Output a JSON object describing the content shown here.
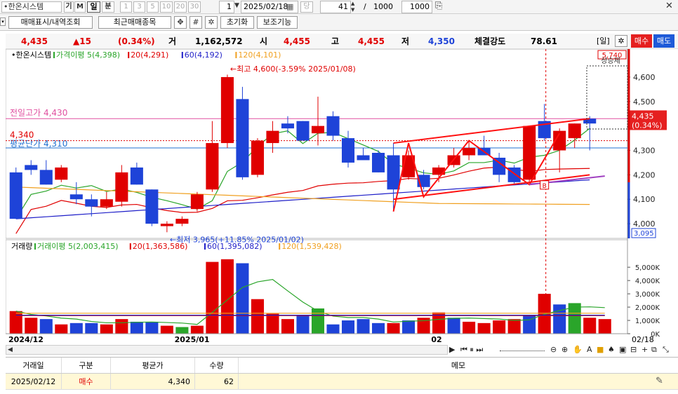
{
  "toolbar": {
    "stock_name": "•한온시스템",
    "period_buttons": [
      "기",
      "M",
      "일",
      "분",
      "1",
      "3",
      "5",
      "10",
      "20",
      "30"
    ],
    "period_dim": [
      false,
      false,
      false,
      false,
      true,
      true,
      true,
      true,
      true,
      true
    ],
    "period_selected": 2,
    "count_field": "1",
    "date_field": "2025/02/18",
    "date_btn2": "당",
    "bars_count": "41",
    "separator": "/",
    "total_bars": "1000",
    "max_bars": "1000"
  },
  "toolbar2": {
    "btn_trade_display": "매매표시/내역조회",
    "btn_recent_items": "최근매매종목",
    "btn_reset": "초기화",
    "btn_aux": "보조기능"
  },
  "infobar": {
    "price": "4,435",
    "change": "▲15",
    "change_pct": "(0.34%)",
    "vol_label": "거",
    "volume": "1,162,572",
    "open_label": "시",
    "open": "4,455",
    "high_label": "고",
    "high": "4,455",
    "low_label": "저",
    "low": "4,350",
    "strength_label": "체결강도",
    "strength": "78.61",
    "period_tag": "[일]",
    "buy_btn": "매수",
    "sell_btn": "매도"
  },
  "chart_data": [
    {
      "type": "candlestick",
      "title": "•한온시스템",
      "legend": [
        {
          "name": "가격이평 5(4,398)",
          "color": "#2aa52a"
        },
        {
          "name": "20(4,291)",
          "color": "#e00000"
        },
        {
          "name": "60(4,192)",
          "color": "#1e1ec8"
        },
        {
          "name": "120(4,101)",
          "color": "#f0a020"
        }
      ],
      "ylim": [
        3940,
        4640
      ],
      "yticks": [
        4000,
        4100,
        4200,
        4300,
        4400,
        4500,
        4600
      ],
      "ytick_labels": [
        "4,000",
        "4,100",
        "4,200",
        "4,300",
        "4,400",
        "4,500",
        "4,600"
      ],
      "candles": [
        {
          "o": 4210,
          "h": 4230,
          "l": 4020,
          "c": 4020
        },
        {
          "o": 4240,
          "h": 4260,
          "l": 4200,
          "c": 4220
        },
        {
          "o": 4220,
          "h": 4260,
          "l": 4160,
          "c": 4160
        },
        {
          "o": 4180,
          "h": 4240,
          "l": 4170,
          "c": 4230
        },
        {
          "o": 4120,
          "h": 4170,
          "l": 4080,
          "c": 4100
        },
        {
          "o": 4100,
          "h": 4120,
          "l": 4030,
          "c": 4070
        },
        {
          "o": 4070,
          "h": 4130,
          "l": 4060,
          "c": 4100
        },
        {
          "o": 4090,
          "h": 4240,
          "l": 4070,
          "c": 4210
        },
        {
          "o": 4230,
          "h": 4250,
          "l": 4160,
          "c": 4160
        },
        {
          "o": 4140,
          "h": 4140,
          "l": 3990,
          "c": 4000
        },
        {
          "o": 3990,
          "h": 4010,
          "l": 3965,
          "c": 4000
        },
        {
          "o": 4000,
          "h": 4030,
          "l": 3990,
          "c": 4020
        },
        {
          "o": 4060,
          "h": 4130,
          "l": 4050,
          "c": 4120
        },
        {
          "o": 4140,
          "h": 4420,
          "l": 4130,
          "c": 4330
        },
        {
          "o": 4330,
          "h": 4610,
          "l": 4310,
          "c": 4600
        },
        {
          "o": 4510,
          "h": 4560,
          "l": 4180,
          "c": 4190
        },
        {
          "o": 4200,
          "h": 4350,
          "l": 4190,
          "c": 4340
        },
        {
          "o": 4330,
          "h": 4420,
          "l": 4290,
          "c": 4380
        },
        {
          "o": 4410,
          "h": 4440,
          "l": 4370,
          "c": 4390
        },
        {
          "o": 4420,
          "h": 4420,
          "l": 4340,
          "c": 4340
        },
        {
          "o": 4370,
          "h": 4520,
          "l": 4320,
          "c": 4400
        },
        {
          "o": 4440,
          "h": 4460,
          "l": 4340,
          "c": 4360
        },
        {
          "o": 4350,
          "h": 4380,
          "l": 4230,
          "c": 4250
        },
        {
          "o": 4280,
          "h": 4310,
          "l": 4270,
          "c": 4260
        },
        {
          "o": 4290,
          "h": 4300,
          "l": 4210,
          "c": 4210
        },
        {
          "o": 4280,
          "h": 4330,
          "l": 4050,
          "c": 4140
        },
        {
          "o": 4190,
          "h": 4300,
          "l": 4180,
          "c": 4280
        },
        {
          "o": 4200,
          "h": 4220,
          "l": 4140,
          "c": 4150
        },
        {
          "o": 4200,
          "h": 4240,
          "l": 4170,
          "c": 4230
        },
        {
          "o": 4240,
          "h": 4310,
          "l": 4230,
          "c": 4280
        },
        {
          "o": 4280,
          "h": 4340,
          "l": 4260,
          "c": 4310
        },
        {
          "o": 4310,
          "h": 4360,
          "l": 4280,
          "c": 4280
        },
        {
          "o": 4270,
          "h": 4290,
          "l": 4170,
          "c": 4200
        },
        {
          "o": 4230,
          "h": 4240,
          "l": 4160,
          "c": 4170
        },
        {
          "o": 4180,
          "h": 4400,
          "l": 4170,
          "c": 4400
        },
        {
          "o": 4420,
          "h": 4490,
          "l": 4340,
          "c": 4350
        },
        {
          "o": 4300,
          "h": 4390,
          "l": 4210,
          "c": 4380
        },
        {
          "o": 4350,
          "h": 4410,
          "l": 4310,
          "c": 4410
        },
        {
          "o": 4430,
          "h": 4440,
          "l": 4300,
          "c": 4410
        }
      ],
      "annotations": {
        "high": "←최고 4,600(-3.59% 2025/01/08)",
        "low": "←최저 3,965(+11.85% 2025/01/02)",
        "prev_high_label": "전일고가 4,430",
        "avg_price_label": "평균단가 4,310",
        "buy_price": "4,340",
        "top_right_badge": "5,740",
        "top_right_tag": "상승제",
        "current_price": "4,435",
        "current_pct": "(0.34%)",
        "low_right": "3,095",
        "marker": "B"
      }
    },
    {
      "type": "bar",
      "title": "거래량",
      "legend": [
        {
          "name": "거래이평 5(2,003,415)",
          "color": "#2aa52a"
        },
        {
          "name": "20(1,363,586)",
          "color": "#e00000"
        },
        {
          "name": "60(1,395,082)",
          "color": "#1e1ec8"
        },
        {
          "name": "120(1,539,428)",
          "color": "#f0a020"
        }
      ],
      "ylim": [
        0,
        5800000
      ],
      "yticks": [
        0,
        1000000,
        2000000,
        3000000,
        4000000,
        5000000
      ],
      "ytick_labels": [
        "0K",
        "1,000K",
        "2,000K",
        "3,000K",
        "4,000K",
        "5,000K"
      ],
      "values": [
        1700000,
        1200000,
        1100000,
        700000,
        800000,
        800000,
        700000,
        1100000,
        900000,
        900000,
        600000,
        500000,
        600000,
        5400000,
        5600000,
        5300000,
        2600000,
        1500000,
        1100000,
        1400000,
        1900000,
        700000,
        1000000,
        1100000,
        800000,
        800000,
        1000000,
        1200000,
        1600000,
        1200000,
        900000,
        800000,
        1000000,
        1100000,
        1400000,
        3000000,
        2200000,
        2300000,
        1200000,
        1100000
      ],
      "colors": [
        "r",
        "r",
        "b",
        "r",
        "b",
        "b",
        "r",
        "r",
        "b",
        "b",
        "r",
        "g",
        "r",
        "r",
        "r",
        "b",
        "r",
        "r",
        "r",
        "b",
        "g",
        "b",
        "b",
        "b",
        "b",
        "r",
        "b",
        "r",
        "r",
        "b",
        "r",
        "r",
        "r",
        "r",
        "b",
        "r",
        "b",
        "g",
        "r",
        "r"
      ],
      "x_labels": [
        {
          "label": "2024/12",
          "index": 0
        },
        {
          "label": "2025/01",
          "index": 11
        },
        {
          "label": "02",
          "index": 28
        },
        {
          "label": "02/18",
          "index": 40
        }
      ]
    }
  ],
  "orders": {
    "headers": [
      "거래일",
      "구분",
      "평균가",
      "수량",
      "메모"
    ],
    "rows": [
      {
        "date": "2025/02/12",
        "side": "매수",
        "price": "4,340",
        "qty": "62",
        "memo": ""
      }
    ]
  }
}
